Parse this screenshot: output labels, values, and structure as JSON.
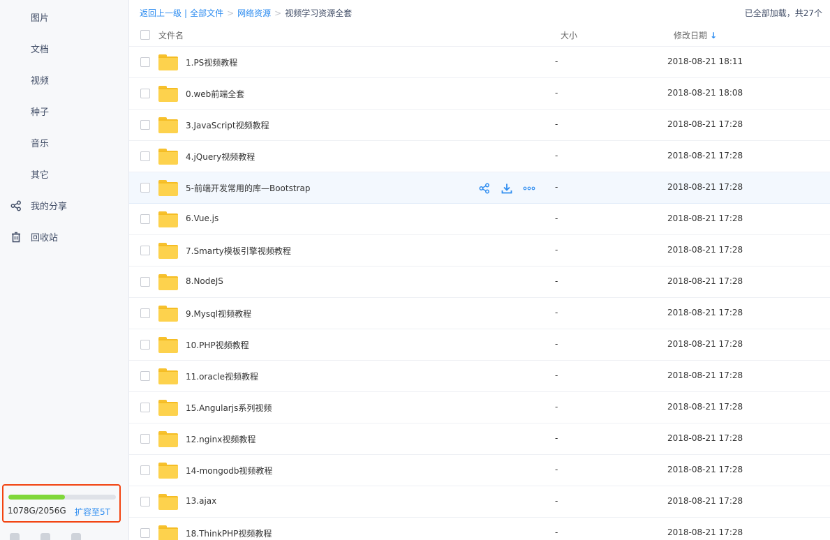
{
  "sidebar": {
    "items": [
      {
        "label": "图片",
        "icon": ""
      },
      {
        "label": "文档",
        "icon": ""
      },
      {
        "label": "视频",
        "icon": ""
      },
      {
        "label": "种子",
        "icon": ""
      },
      {
        "label": "音乐",
        "icon": ""
      },
      {
        "label": "其它",
        "icon": ""
      },
      {
        "label": "我的分享",
        "icon": "share-icon"
      },
      {
        "label": "回收站",
        "icon": "trash-icon"
      }
    ],
    "quota": {
      "used_text": "1078G/2056G",
      "upgrade_label": "扩容至5T",
      "used_fraction": 0.524
    }
  },
  "breadcrumb": {
    "back": "返回上一级",
    "items": [
      "全部文件",
      "网络资源"
    ],
    "current": "视频学习资源全套"
  },
  "load_status": "已全部加载，共27个",
  "table": {
    "columns": {
      "name": "文件名",
      "size": "大小",
      "modified": "修改日期",
      "sort_icon": "↓"
    },
    "rows": [
      {
        "name": "1.PS视频教程",
        "size": "-",
        "date": "2018-08-21 18:11"
      },
      {
        "name": "0.web前端全套",
        "size": "-",
        "date": "2018-08-21 18:08"
      },
      {
        "name": "3.JavaScript视频教程",
        "size": "-",
        "date": "2018-08-21 17:28"
      },
      {
        "name": "4.jQuery视频教程",
        "size": "-",
        "date": "2018-08-21 17:28"
      },
      {
        "name": "5-前端开发常用的库—Bootstrap",
        "size": "-",
        "date": "2018-08-21 17:28"
      },
      {
        "name": "6.Vue.js",
        "size": "-",
        "date": "2018-08-21 17:28"
      },
      {
        "name": "7.Smarty模板引擎视频教程",
        "size": "-",
        "date": "2018-08-21 17:28"
      },
      {
        "name": "8.NodeJS",
        "size": "-",
        "date": "2018-08-21 17:28"
      },
      {
        "name": "9.Mysql视频教程",
        "size": "-",
        "date": "2018-08-21 17:28"
      },
      {
        "name": "10.PHP视频教程",
        "size": "-",
        "date": "2018-08-21 17:28"
      },
      {
        "name": "11.oracle视频教程",
        "size": "-",
        "date": "2018-08-21 17:28"
      },
      {
        "name": "15.Angularjs系列视频",
        "size": "-",
        "date": "2018-08-21 17:28"
      },
      {
        "name": "12.nginx视频教程",
        "size": "-",
        "date": "2018-08-21 17:28"
      },
      {
        "name": "14-mongodb视频教程",
        "size": "-",
        "date": "2018-08-21 17:28"
      },
      {
        "name": "13.ajax",
        "size": "-",
        "date": "2018-08-21 17:28"
      },
      {
        "name": "18.ThinkPHP视频教程",
        "size": "-",
        "date": "2018-08-21 17:28"
      }
    ],
    "hovered_row": 4,
    "row_actions": [
      "share-icon",
      "download-icon",
      "more-icon"
    ]
  },
  "colors": {
    "accent": "#2d8cf0",
    "quota_fill": "#7fd73a",
    "highlight_border": "#f2420f",
    "folder": "#fdd24d"
  }
}
